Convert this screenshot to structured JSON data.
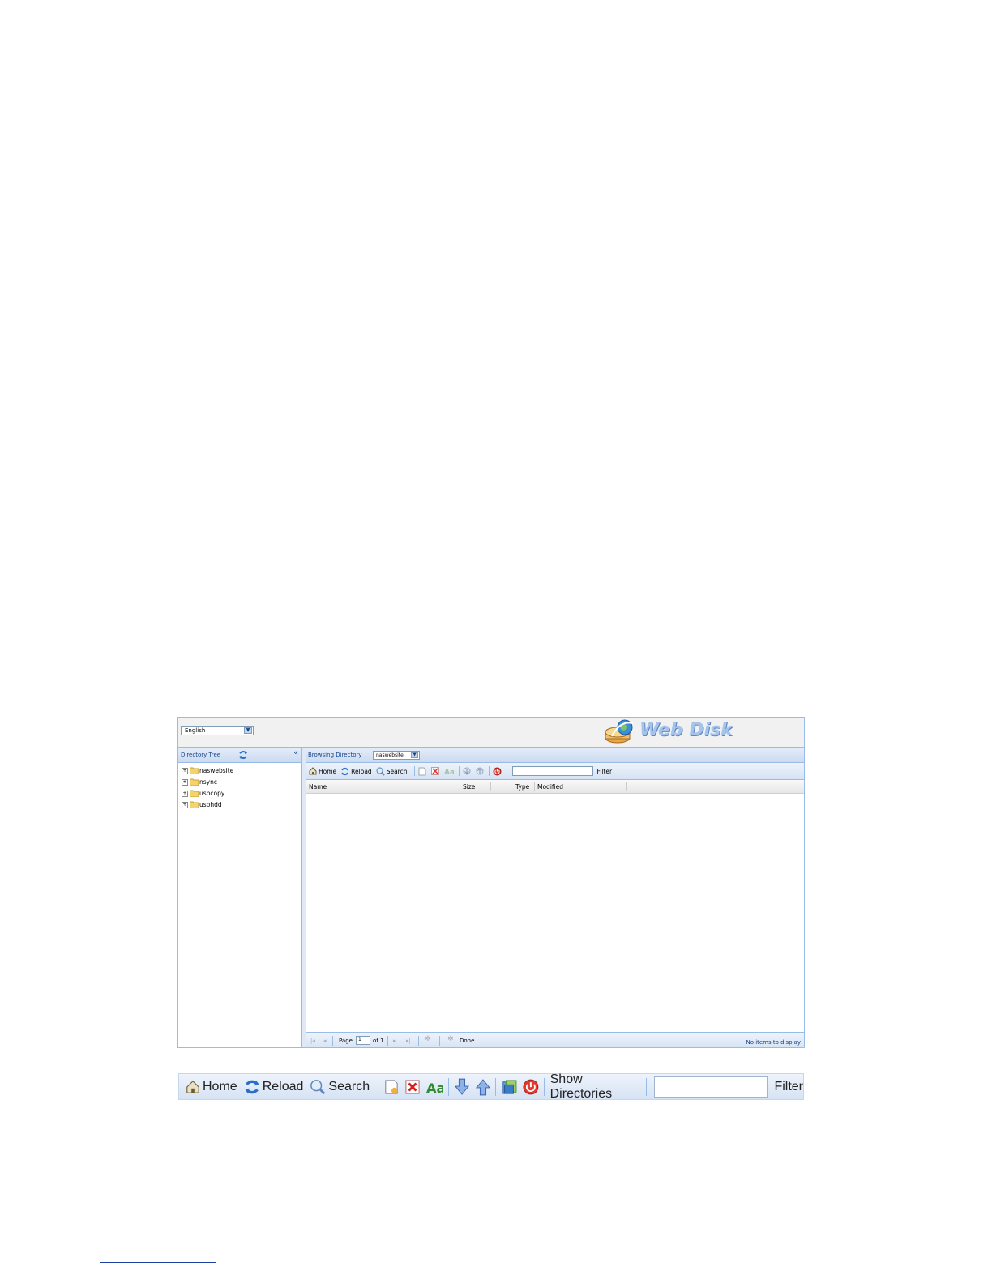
{
  "topbar": {
    "language": "English",
    "logo_text": "Web Disk"
  },
  "left_panel": {
    "title": "Directory Tree",
    "tree": [
      "naswebsite",
      "nsync",
      "usbcopy",
      "usbhdd"
    ]
  },
  "main_panel": {
    "title": "Browsing Directory",
    "directory": "naswebsite",
    "toolbar": {
      "home": "Home",
      "reload": "Reload",
      "search": "Search",
      "filter": "Filter"
    },
    "columns": [
      "Name",
      "Size",
      "Type",
      "Modified"
    ],
    "pager": {
      "page_label": "Page",
      "page_value": "1",
      "of_label": "of 1",
      "status": "Done.",
      "empty": "No items to display"
    }
  },
  "enlarged_toolbar": {
    "home": "Home",
    "reload": "Reload",
    "search": "Search",
    "show_directories": "Show Directories",
    "filter": "Filter"
  },
  "colors": {
    "accent": "#15428b",
    "border": "#99bbe8",
    "header_bg": "#dfe8f6"
  }
}
